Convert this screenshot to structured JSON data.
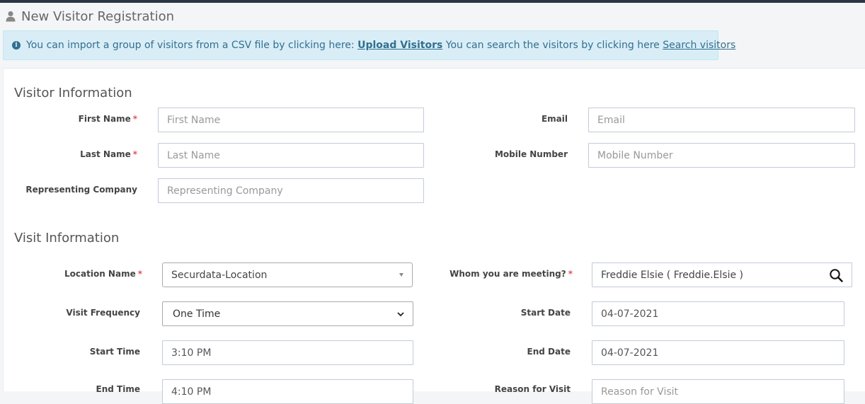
{
  "page": {
    "title": "New Visitor Registration"
  },
  "alert": {
    "text1": "You can import a group of visitors from a CSV file by clicking here:",
    "link1": "Upload Visitors",
    "text2": "You can search the visitors by clicking here",
    "link2": "Search visitors"
  },
  "visitor_info": {
    "title": "Visitor Information",
    "first_name": {
      "label": "First Name",
      "required": "*",
      "placeholder": "First Name"
    },
    "last_name": {
      "label": "Last Name",
      "required": "*",
      "placeholder": "Last Name"
    },
    "company": {
      "label": "Representing Company",
      "placeholder": "Representing Company"
    },
    "email": {
      "label": "Email",
      "placeholder": "Email"
    },
    "mobile": {
      "label": "Mobile Number",
      "placeholder": "Mobile Number"
    }
  },
  "visit_info": {
    "title": "Visit Information",
    "location": {
      "label": "Location Name",
      "required": "*",
      "value": "Securdata-Location"
    },
    "frequency": {
      "label": "Visit Frequency",
      "value": "One Time"
    },
    "start_time": {
      "label": "Start Time",
      "value": "3:10 PM"
    },
    "end_time": {
      "label": "End Time",
      "value": "4:10 PM"
    },
    "meeting": {
      "label": "Whom you are meeting?",
      "required": "*",
      "value": "Freddie Elsie ( Freddie.Elsie )"
    },
    "start_date": {
      "label": "Start Date",
      "value": "04-07-2021"
    },
    "end_date": {
      "label": "End Date",
      "value": "04-07-2021"
    },
    "reason": {
      "label": "Reason for Visit",
      "placeholder": "Reason for Visit"
    }
  },
  "icons": {
    "user": "user-icon",
    "info": "info-circle-icon",
    "search": "search-icon",
    "select_caret": "caret-down-icon",
    "select_chevron": "chevron-down-icon"
  },
  "colors": {
    "topbar": "#2b3643",
    "alert_bg": "#d9edf7",
    "alert_text": "#31708f",
    "required": "#e7505a",
    "input_border": "#c2cad8"
  }
}
